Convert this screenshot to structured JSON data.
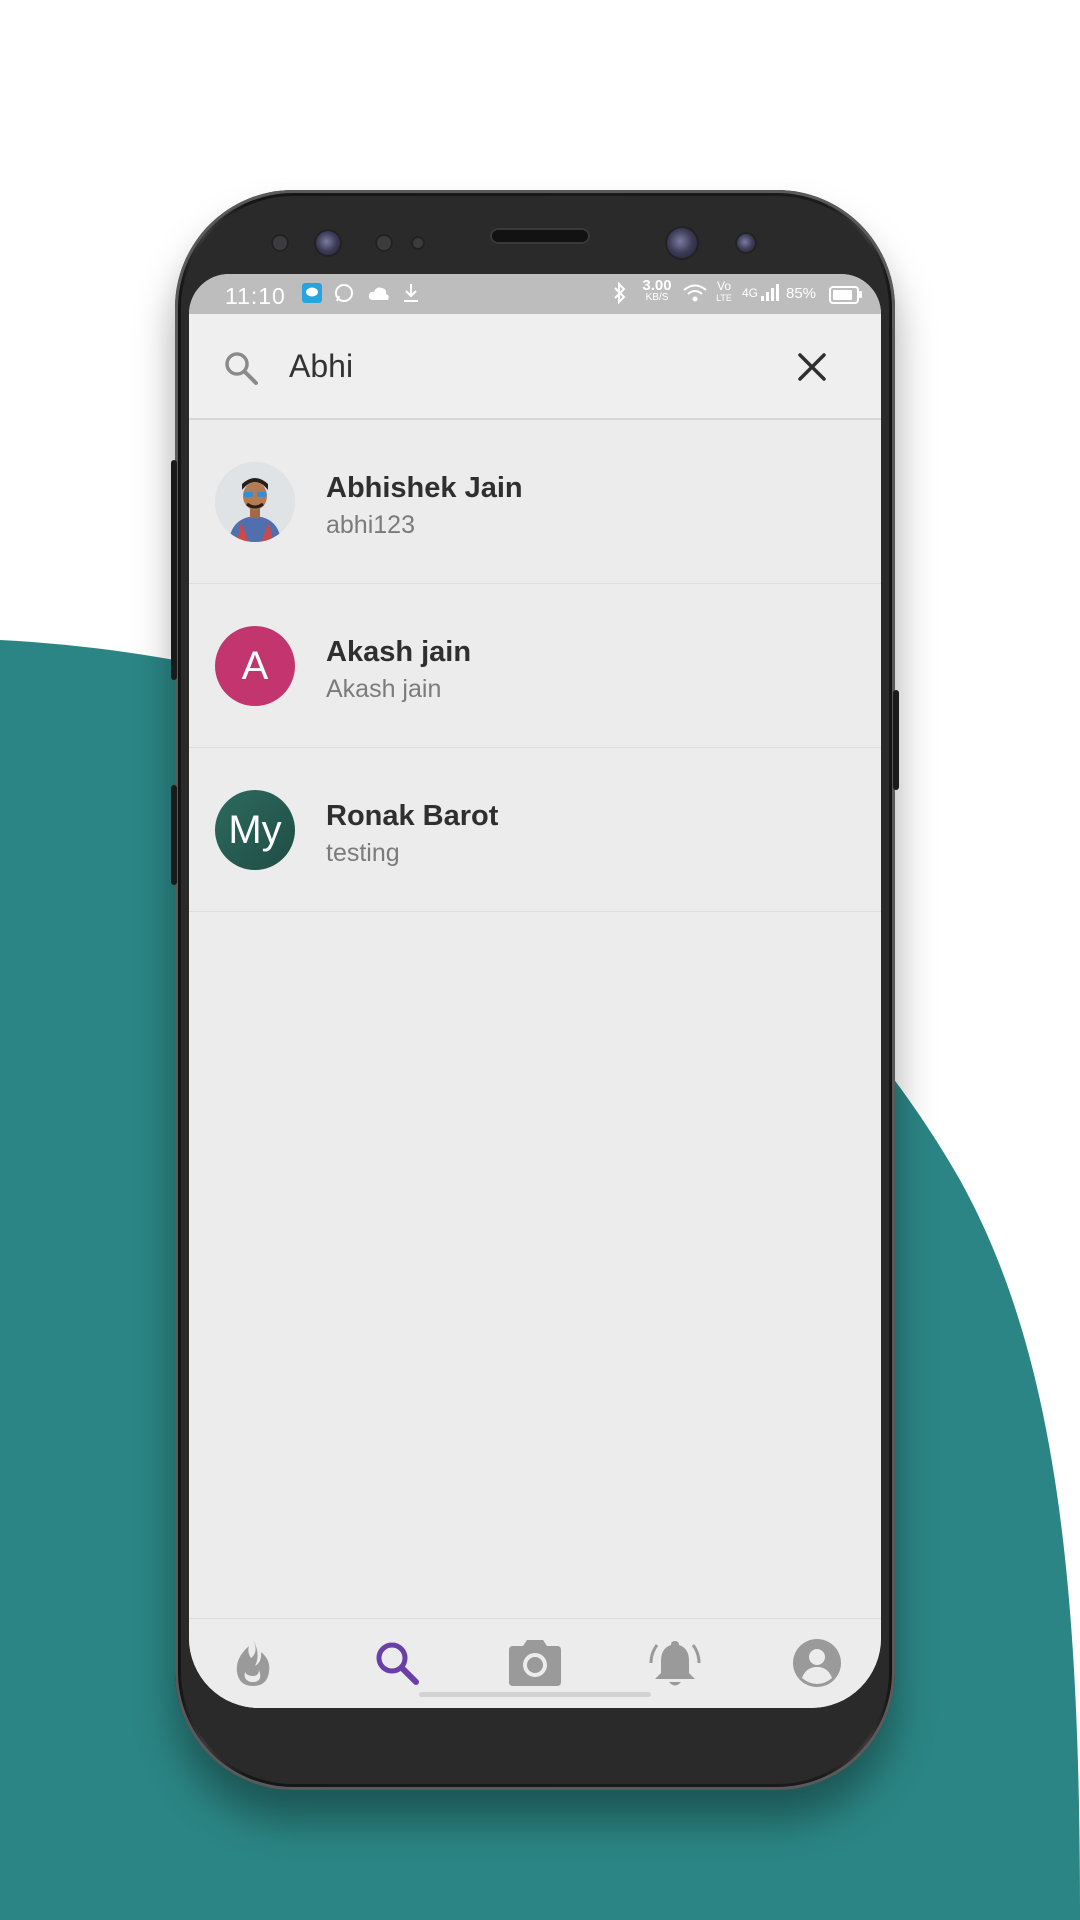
{
  "colors": {
    "background_accent": "#2b8584",
    "active_nav": "#6a3fa8",
    "inactive_nav": "#9a9a9a",
    "avatar_pink": "#c2356e",
    "avatar_green": "#2d6a5e"
  },
  "status_bar": {
    "time": "11:10",
    "network_speed_value": "3.00",
    "network_speed_unit": "KB/S",
    "volte_top": "Vo",
    "volte_bottom": "LTE",
    "signal_label": "4G",
    "battery_percent": "85%",
    "battery_level": 0.85,
    "left_icons": [
      "message-app-icon",
      "whatsapp-icon",
      "cloud-icon",
      "download-icon"
    ],
    "right_icons": [
      "bluetooth-icon",
      "network-speed",
      "wifi-icon",
      "volte-icon",
      "signal-icon",
      "battery-icon"
    ]
  },
  "search": {
    "value": "Abhi",
    "icon": "search-icon",
    "clear_icon": "close-icon"
  },
  "results": [
    {
      "name": "Abhishek Jain",
      "subtitle": "abhi123",
      "avatar_type": "photo",
      "avatar_initials": ""
    },
    {
      "name": "Akash jain",
      "subtitle": "Akash jain",
      "avatar_type": "initials",
      "avatar_initials": "A"
    },
    {
      "name": "Ronak Barot",
      "subtitle": "testing",
      "avatar_type": "initials",
      "avatar_initials": "My"
    }
  ],
  "bottom_nav": [
    {
      "icon": "flame-icon",
      "active": false
    },
    {
      "icon": "search-icon",
      "active": true
    },
    {
      "icon": "camera-icon",
      "active": false
    },
    {
      "icon": "notification-bell-icon",
      "active": false
    },
    {
      "icon": "profile-icon",
      "active": false
    }
  ]
}
